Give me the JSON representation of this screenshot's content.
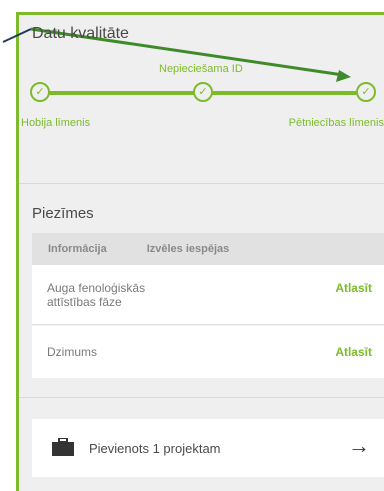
{
  "colors": {
    "accent": "#7dbb2c",
    "panel_bg": "#efefef"
  },
  "data_quality": {
    "title": "Datu kvalitāte",
    "required_id_label": "Nepieciešama ID",
    "levels": {
      "left": "Hobija līmenis",
      "right": "Pētniecības līmenis"
    },
    "checkmark_glyph": "✓"
  },
  "notes": {
    "title": "Piezīmes",
    "tabs": [
      "Informācija",
      "Izvēles iespējas"
    ],
    "rows": [
      {
        "label": "Auga fenoloģiskās attīstības fāze",
        "action": "Atlasīt"
      },
      {
        "label": "Dzimums",
        "action": "Atlasīt"
      }
    ]
  },
  "project": {
    "label": "Pievienots 1 projektam",
    "arrow_glyph": "→"
  }
}
